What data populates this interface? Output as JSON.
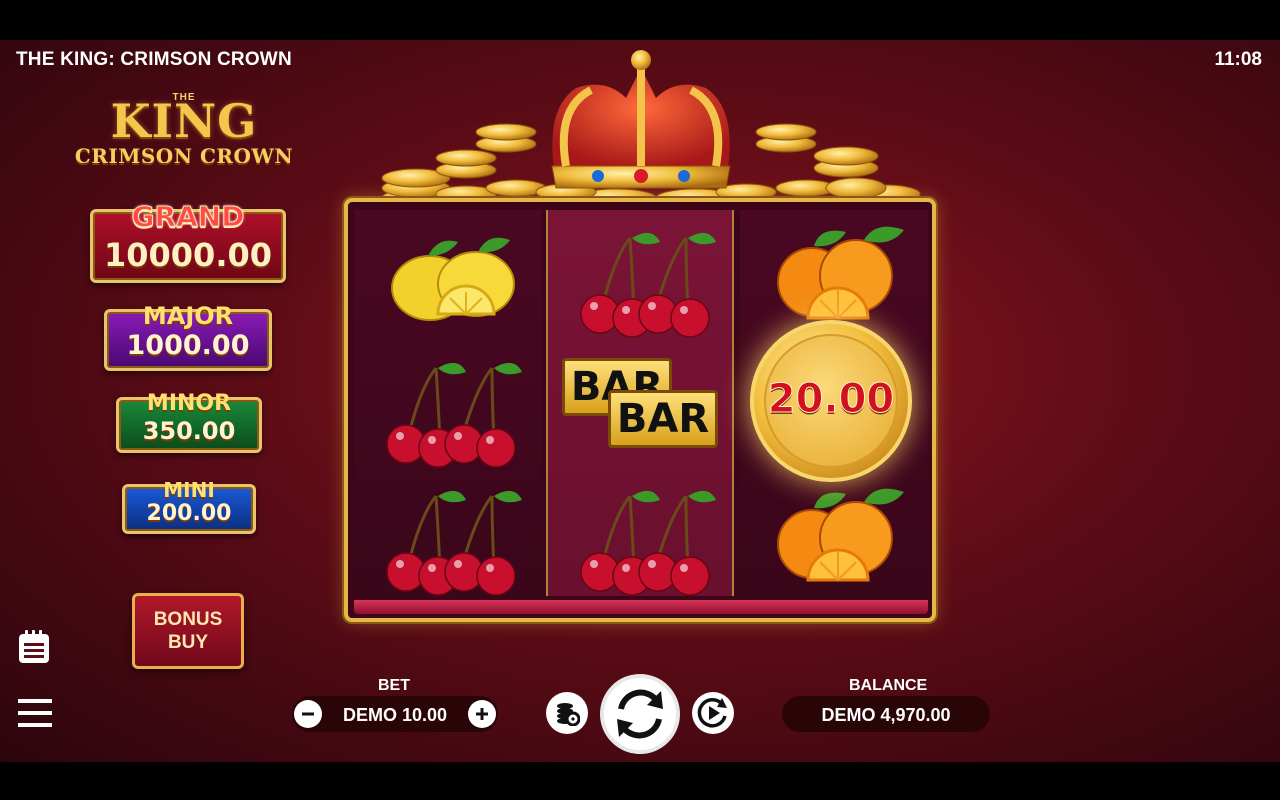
{
  "header": {
    "title": "THE KING: CRIMSON CROWN",
    "time": "11:08"
  },
  "logo": {
    "the": "THE",
    "king": "KING",
    "subtitle": "CRIMSON CROWN"
  },
  "jackpots": [
    {
      "label": "GRAND",
      "value": "10000.00"
    },
    {
      "label": "MAJOR",
      "value": "1000.00"
    },
    {
      "label": "MINOR",
      "value": "350.00"
    },
    {
      "label": "MINI",
      "value": "200.00"
    }
  ],
  "bonus_buy": {
    "label": "BONUS BUY"
  },
  "reels": {
    "reel1": [
      "lemon-icon",
      "cherries-icon",
      "cherries-icon"
    ],
    "reel2": [
      "cherries-icon",
      "double-bar-icon",
      "cherries-icon"
    ],
    "reel3": [
      "orange-icon",
      "coin-icon",
      "orange-icon"
    ]
  },
  "coin": {
    "value": "20.00"
  },
  "bar": {
    "top": "BAR",
    "bottom": "BAR"
  },
  "controls": {
    "bet_label": "BET",
    "bet_value": "DEMO 10.00",
    "balance_label": "BALANCE",
    "balance_value": "DEMO 4,970.00"
  },
  "colors": {
    "background": "#5e0c16",
    "gold": "#e6b648",
    "grand": "#b01028",
    "major": "#8a1bb6",
    "minor": "#1a8a3a",
    "mini": "#1a5ad8"
  }
}
